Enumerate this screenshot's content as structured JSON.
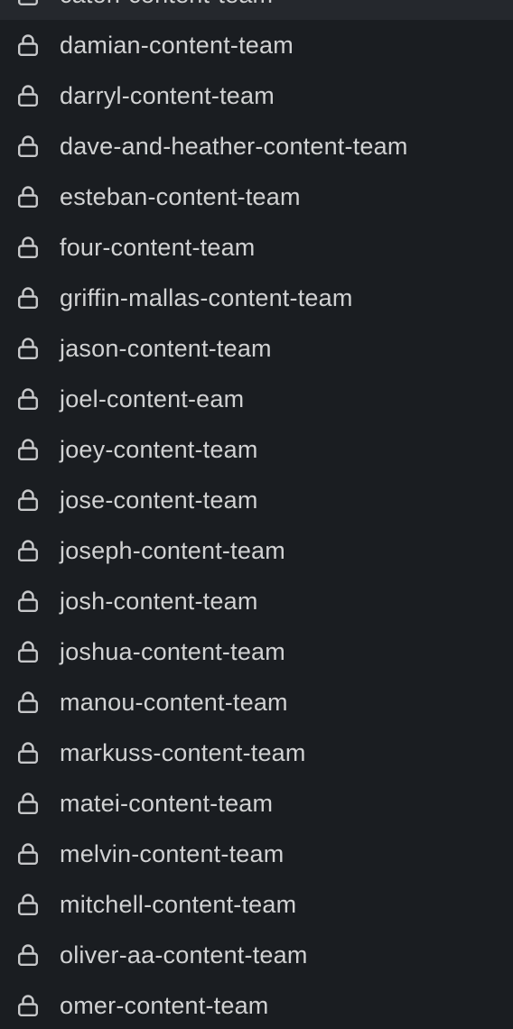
{
  "sidebar": {
    "private_channels": [
      {
        "name": "caton-content-team",
        "icon": "lock-icon",
        "highlighted": true
      },
      {
        "name": "damian-content-team",
        "icon": "lock-icon"
      },
      {
        "name": "darryl-content-team",
        "icon": "lock-icon"
      },
      {
        "name": "dave-and-heather-content-team",
        "icon": "lock-icon"
      },
      {
        "name": "esteban-content-team",
        "icon": "lock-icon"
      },
      {
        "name": "four-content-team",
        "icon": "lock-icon"
      },
      {
        "name": "griffin-mallas-content-team",
        "icon": "lock-icon"
      },
      {
        "name": "jason-content-team",
        "icon": "lock-icon"
      },
      {
        "name": "joel-content-eam",
        "icon": "lock-icon"
      },
      {
        "name": "joey-content-team",
        "icon": "lock-icon"
      },
      {
        "name": "jose-content-team",
        "icon": "lock-icon"
      },
      {
        "name": "joseph-content-team",
        "icon": "lock-icon"
      },
      {
        "name": "josh-content-team",
        "icon": "lock-icon"
      },
      {
        "name": "joshua-content-team",
        "icon": "lock-icon"
      },
      {
        "name": "manou-content-team",
        "icon": "lock-icon"
      },
      {
        "name": "markuss-content-team",
        "icon": "lock-icon"
      },
      {
        "name": "matei-content-team",
        "icon": "lock-icon"
      },
      {
        "name": "melvin-content-team",
        "icon": "lock-icon"
      },
      {
        "name": "mitchell-content-team",
        "icon": "lock-icon"
      },
      {
        "name": "oliver-aa-content-team",
        "icon": "lock-icon"
      },
      {
        "name": "omer-content-team",
        "icon": "lock-icon"
      }
    ]
  },
  "colors": {
    "background": "#1a1d21",
    "highlight": "#25282d",
    "text": "#d1d2d3",
    "icon": "#c7c8ca"
  }
}
